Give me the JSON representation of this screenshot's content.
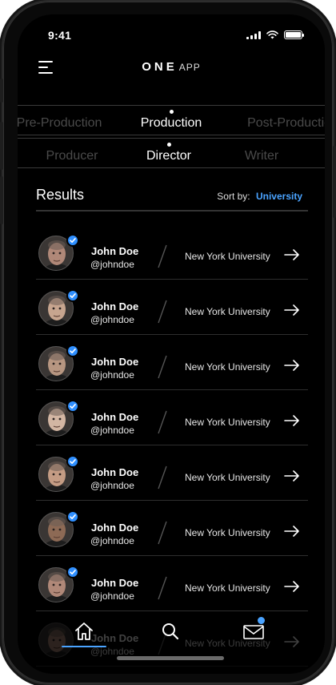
{
  "status_bar": {
    "time": "9:41"
  },
  "header": {
    "brand_bold": "ONE",
    "brand_light": "APP"
  },
  "category_tabs": [
    {
      "label": "Pre-Production",
      "active": false
    },
    {
      "label": "Production",
      "active": true
    },
    {
      "label": "Post-Production",
      "active": false
    }
  ],
  "role_tabs": [
    {
      "label": "Producer",
      "active": false
    },
    {
      "label": "Director",
      "active": true
    },
    {
      "label": "Writer",
      "active": false
    }
  ],
  "results": {
    "title": "Results",
    "sort_label": "Sort by:",
    "sort_value": "University",
    "items": [
      {
        "name": "John Doe",
        "handle": "@johndoe",
        "school": "New York University",
        "verified": true
      },
      {
        "name": "John Doe",
        "handle": "@johndoe",
        "school": "New York University",
        "verified": true
      },
      {
        "name": "John Doe",
        "handle": "@johndoe",
        "school": "New York University",
        "verified": true
      },
      {
        "name": "John Doe",
        "handle": "@johndoe",
        "school": "New York University",
        "verified": true
      },
      {
        "name": "John Doe",
        "handle": "@johndoe",
        "school": "New York University",
        "verified": true
      },
      {
        "name": "John Doe",
        "handle": "@johndoe",
        "school": "New York University",
        "verified": true
      },
      {
        "name": "John Doe",
        "handle": "@johndoe",
        "school": "New York University",
        "verified": true
      },
      {
        "name": "John Doe",
        "handle": "@johndoe",
        "school": "New York University",
        "verified": false
      }
    ]
  },
  "bottom_nav": [
    {
      "icon": "home-icon",
      "active": true
    },
    {
      "icon": "search-icon",
      "active": false
    },
    {
      "icon": "mail-icon",
      "active": false,
      "badge": true
    }
  ],
  "colors": {
    "accent": "#4aa3ff",
    "verified": "#2f8fff",
    "background": "#000000"
  }
}
